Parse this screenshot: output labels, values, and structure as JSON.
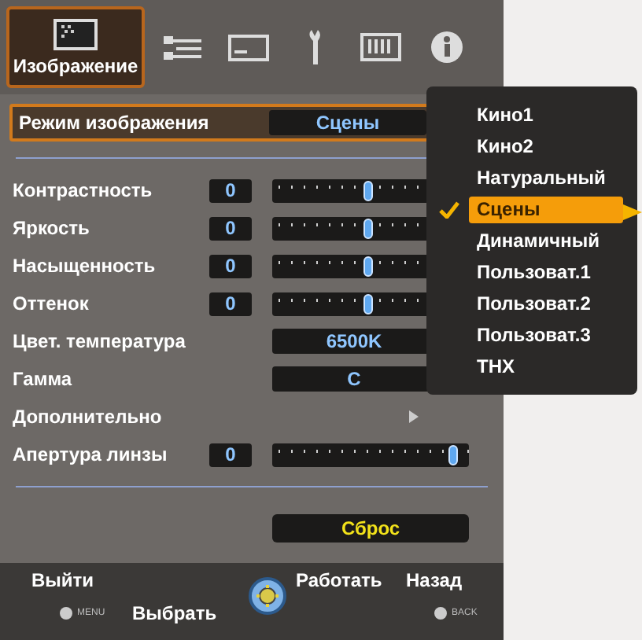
{
  "tabs": [
    {
      "label": "Изображение",
      "selected": true
    },
    {
      "selected": false
    },
    {
      "selected": false
    },
    {
      "selected": false
    },
    {
      "selected": false
    },
    {
      "selected": false
    }
  ],
  "settings": [
    {
      "kind": "select",
      "label": "Режим изображения",
      "value": "Сцены",
      "focused": true
    },
    {
      "kind": "slider",
      "label": "Контрастность",
      "value": "0",
      "level": 0.49
    },
    {
      "kind": "slider",
      "label": "Яркость",
      "value": "0",
      "level": 0.49
    },
    {
      "kind": "slider",
      "label": "Насыщенность",
      "value": "0",
      "level": 0.49
    },
    {
      "kind": "slider",
      "label": "Оттенок",
      "value": "0",
      "level": 0.49
    },
    {
      "kind": "value",
      "label": "Цвет. температура",
      "value": "6500K"
    },
    {
      "kind": "value",
      "label": "Гамма",
      "value": "C"
    },
    {
      "kind": "submenu",
      "label": "Дополнительно"
    },
    {
      "kind": "slider",
      "label": "Апертура линзы",
      "value": "0",
      "level": 0.92
    }
  ],
  "reset_button": "Сброс",
  "popup": {
    "options": [
      {
        "label": "Кино1",
        "selected": false
      },
      {
        "label": "Кино2",
        "selected": false
      },
      {
        "label": "Натуральный",
        "selected": false
      },
      {
        "label": "Сцены",
        "selected": true
      },
      {
        "label": "Динамичный",
        "selected": false
      },
      {
        "label": "Пользоват.1",
        "selected": false
      },
      {
        "label": "Пользоват.2",
        "selected": false
      },
      {
        "label": "Пользоват.3",
        "selected": false
      },
      {
        "label": "THX",
        "selected": false
      }
    ]
  },
  "footer": {
    "exit": "Выйти",
    "exit_key": "MENU",
    "select": "Выбрать",
    "operate": "Работать",
    "back": "Назад",
    "back_key": "BACK"
  }
}
